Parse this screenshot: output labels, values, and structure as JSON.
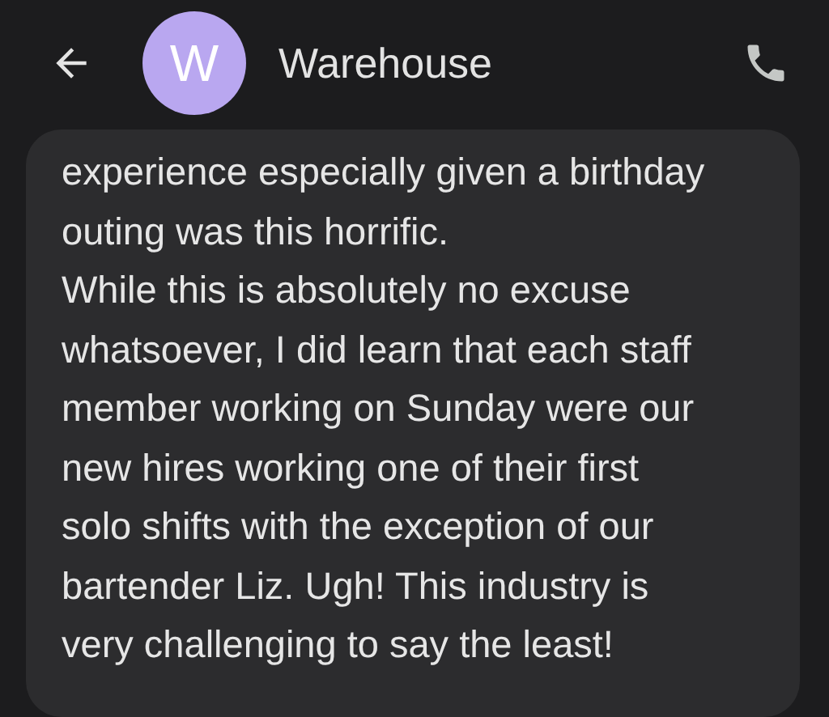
{
  "header": {
    "avatar_letter": "W",
    "title": "Warehouse"
  },
  "message": {
    "lines": [
      "experience especially given a birthday",
      "outing was this horrific.",
      "While this is absolutely no excuse",
      "whatsoever, I did learn that each staff",
      "member working on Sunday were our",
      "new hires working one of their first",
      "solo shifts with the exception of our",
      "bartender Liz. Ugh! This industry is",
      "very challenging to say the least!"
    ]
  }
}
